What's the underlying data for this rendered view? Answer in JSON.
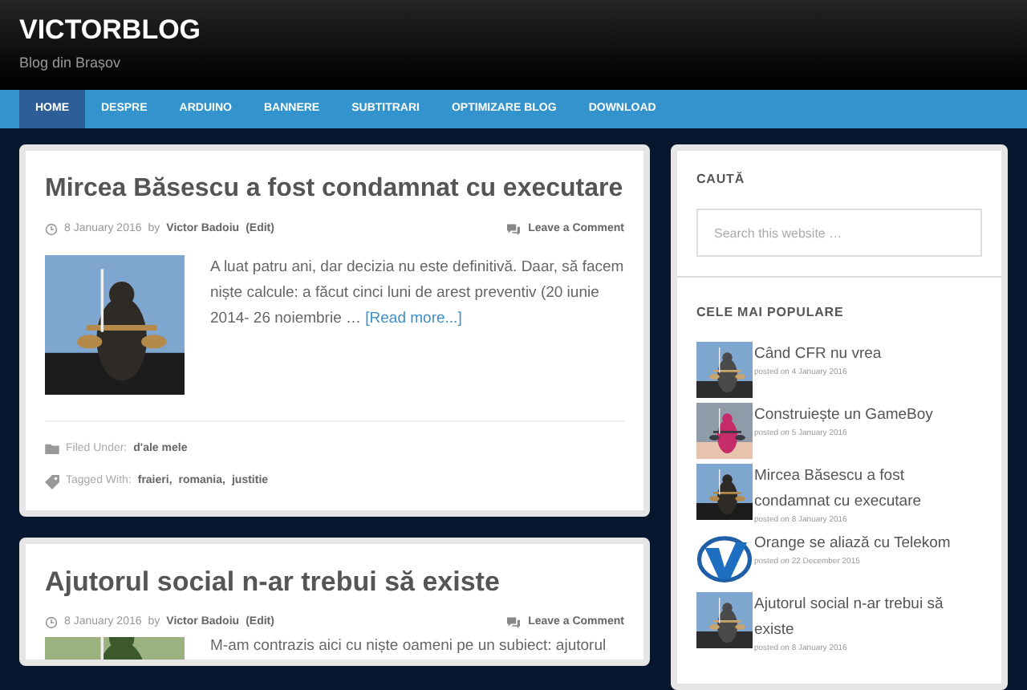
{
  "site": {
    "title": "VICTORBLOG",
    "tagline": "Blog din Brașov"
  },
  "nav": [
    {
      "label": "HOME",
      "selected": true
    },
    {
      "label": "DESPRE",
      "selected": false
    },
    {
      "label": "ARDUINO",
      "selected": false
    },
    {
      "label": "BANNERE",
      "selected": false
    },
    {
      "label": "SUBTITRARI",
      "selected": false
    },
    {
      "label": "OPTIMIZARE BLOG",
      "selected": false
    },
    {
      "label": "DOWNLOAD",
      "selected": false
    }
  ],
  "posts": [
    {
      "title": "Mircea Băsescu a fost condamnat cu executare",
      "date": "8 January 2016",
      "by": "by",
      "author": "Victor Badoiu",
      "edit": "(Edit)",
      "comments": "Leave a Comment",
      "excerpt": "A luat patru ani, dar decizia nu este definitivă. Daar, să facem niște calcule: a făcut cinci luni de arest preventiv (20 iunie 2014- 26 noiembrie …",
      "read_more": "[Read more...]",
      "filed_label": "Filed Under:",
      "category": "d'ale mele",
      "tagged_label": "Tagged With:",
      "tags": [
        "fraieri",
        "romania",
        "justitie"
      ],
      "tag_separator": ","
    },
    {
      "title": "Ajutorul social n-ar trebui să existe",
      "date": "8 January 2016",
      "by": "by",
      "author": "Victor Badoiu",
      "edit": "(Edit)",
      "comments": "Leave a Comment",
      "excerpt": "M-am contrazis aici cu niște oameni pe un subiect: ajutorul"
    }
  ],
  "sidebar": {
    "search": {
      "heading": "CAUTĂ",
      "placeholder": "Search this website …"
    },
    "popular": {
      "heading": "CELE MAI POPULARE",
      "items": [
        {
          "title": "Când CFR nu vrea",
          "date": "posted on 4 January 2016",
          "kind": "picture"
        },
        {
          "title": "Construiește un GameBoy",
          "date": "posted on 5 January 2016",
          "kind": "picture"
        },
        {
          "title": "Mircea Băsescu a fost condamnat cu executare",
          "date": "posted on 8 January 2016",
          "kind": "picture"
        },
        {
          "title": "Orange se aliază cu Telekom",
          "date": "posted on 22 December 2015",
          "kind": "logo"
        },
        {
          "title": "Ajutorul social n-ar trebui să existe",
          "date": "posted on 8 January 2016",
          "kind": "picture"
        }
      ]
    }
  }
}
